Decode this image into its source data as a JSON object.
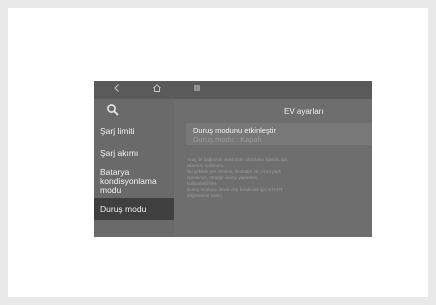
{
  "header": {
    "title": "EV ayarları"
  },
  "topbar": {
    "back_icon": "chevron-left-icon",
    "home_icon": "home-icon",
    "menu_icon": "menu-icon"
  },
  "sidebar": {
    "search_icon": "search-icon",
    "items": [
      {
        "label": "Şarj limiti"
      },
      {
        "label": "Şarj akımı"
      },
      {
        "label": "Batarya kondisyonlama modu"
      },
      {
        "label": "Duruş modu"
      }
    ]
  },
  "main": {
    "option": {
      "title": "Duruş modunu etkinleştir",
      "subtitle": "Duruş modu : Kapalı"
    },
    "description_lines": [
      "Araç ile bağlantılı elektronik cihazların işletimi için",
      "akümün kullanımı.",
      "Bu şekilde ses sistemi, lambalar ve, uzun park",
      "süresince, örneğin kamp yaparken,",
      "kullanılabilirler.",
      "Duruş modunu devre dışı bırakmak için START",
      "düğmesine basın."
    ]
  },
  "colors": {
    "background": "#ffffff",
    "screen": "#6e6e6e",
    "active_item": "#3f3f3f"
  }
}
